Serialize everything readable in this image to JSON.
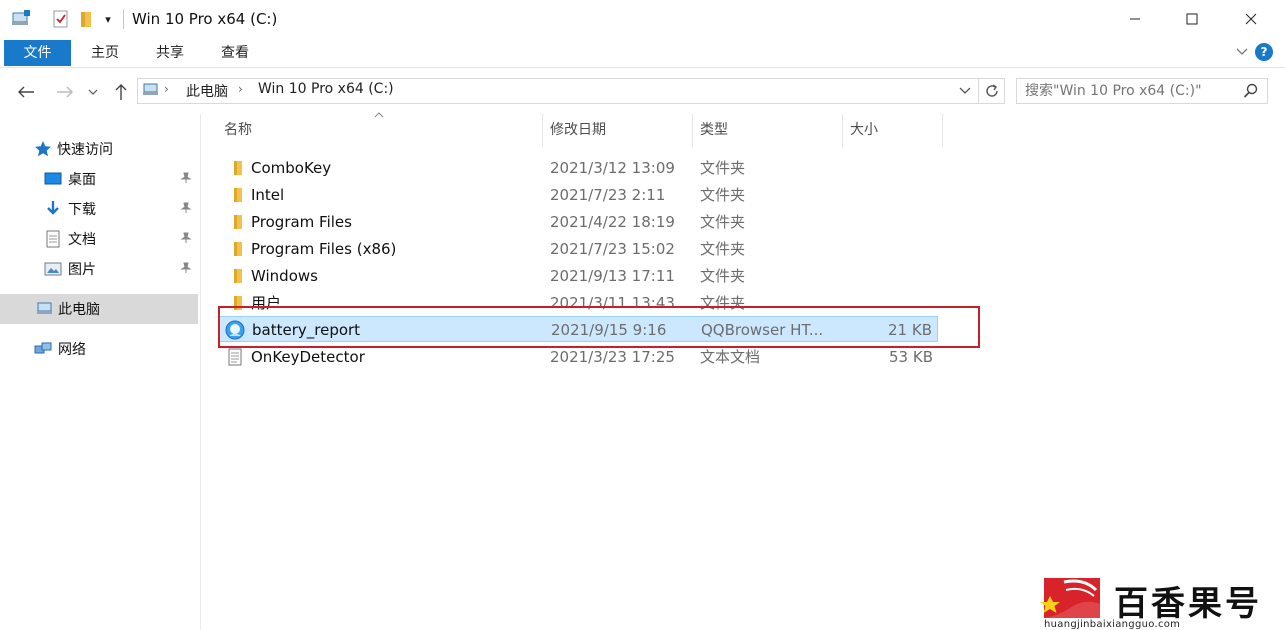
{
  "window": {
    "title": "Win 10 Pro x64 (C:)",
    "quick_access_dropdown": "▾"
  },
  "ribbon": {
    "tabs": [
      {
        "label": "文件",
        "active": true
      },
      {
        "label": "主页"
      },
      {
        "label": "共享"
      },
      {
        "label": "查看"
      }
    ],
    "help": "?"
  },
  "address": {
    "path": [
      "此电脑",
      "Win 10 Pro x64 (C:)"
    ],
    "search_placeholder": "搜索\"Win 10 Pro x64 (C:)\""
  },
  "nav": {
    "items": [
      {
        "label": "快速访问",
        "icon": "star-icon"
      },
      {
        "label": "桌面",
        "icon": "desktop-icon",
        "pinned": true
      },
      {
        "label": "下载",
        "icon": "download-icon",
        "pinned": true
      },
      {
        "label": "文档",
        "icon": "document-icon",
        "pinned": true
      },
      {
        "label": "图片",
        "icon": "pictures-icon",
        "pinned": true
      },
      {
        "label": "此电脑",
        "icon": "computer-icon",
        "selected": true
      },
      {
        "label": "网络",
        "icon": "network-icon"
      }
    ]
  },
  "columns": {
    "name": "名称",
    "date": "修改日期",
    "type": "类型",
    "size": "大小"
  },
  "files": [
    {
      "name": "ComboKey",
      "date": "2021/3/12 13:09",
      "type": "文件夹",
      "size": "",
      "icon": "folder-icon"
    },
    {
      "name": "Intel",
      "date": "2021/7/23 2:11",
      "type": "文件夹",
      "size": "",
      "icon": "folder-icon"
    },
    {
      "name": "Program Files",
      "date": "2021/4/22 18:19",
      "type": "文件夹",
      "size": "",
      "icon": "folder-icon"
    },
    {
      "name": "Program Files (x86)",
      "date": "2021/7/23 15:02",
      "type": "文件夹",
      "size": "",
      "icon": "folder-icon"
    },
    {
      "name": "Windows",
      "date": "2021/9/13 17:11",
      "type": "文件夹",
      "size": "",
      "icon": "folder-icon"
    },
    {
      "name": "用户",
      "date": "2021/3/11 13:43",
      "type": "文件夹",
      "size": "",
      "icon": "folder-icon"
    },
    {
      "name": "battery_report",
      "date": "2021/9/15 9:16",
      "type": "QQBrowser HT...",
      "size": "21 KB",
      "icon": "browser-file-icon",
      "selected": true
    },
    {
      "name": "OnKeyDetector",
      "date": "2021/3/23 17:25",
      "type": "文本文档",
      "size": "53 KB",
      "icon": "text-file-icon"
    }
  ],
  "watermark": {
    "title": "百香果号",
    "url": "huangjinbaixiangguo.com"
  },
  "colors": {
    "accent": "#1979ca",
    "selection": "#cce8ff",
    "highlight_box": "#c8202a",
    "folder": "#f2c14e"
  }
}
